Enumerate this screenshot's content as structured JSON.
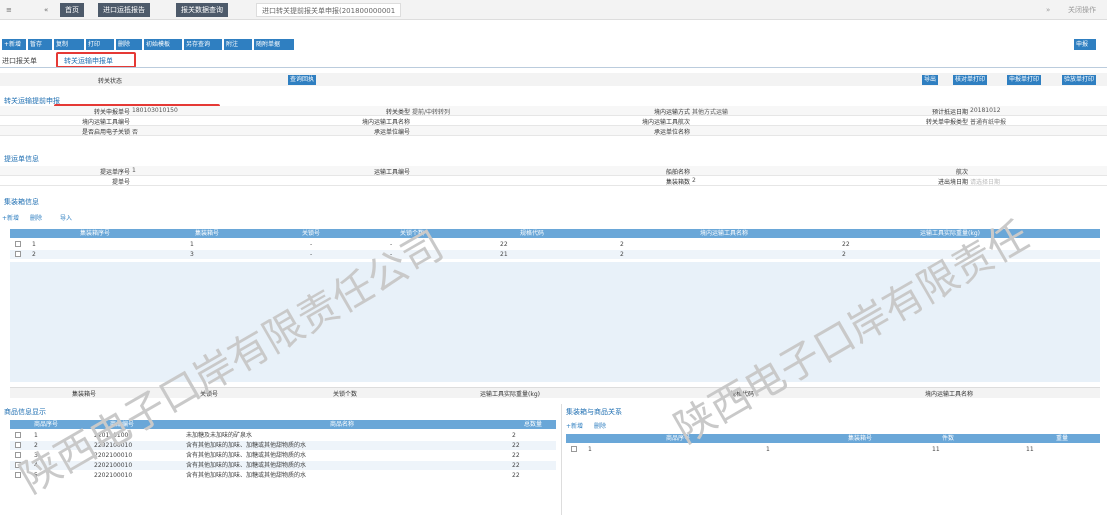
{
  "tabbar": {
    "menu": "≡",
    "back": "«",
    "home": "首页",
    "tab1": "进口运抵报告",
    "tab2": "报关数据查询",
    "tab3": "进口转关提前报关单申报(201800000001",
    "forward": "»",
    "close_ops": "关闭操作"
  },
  "toolbar": {
    "buttons": [
      "+新增",
      "暂存",
      "复制",
      "打印",
      "删除",
      "初始模板",
      "另存查询",
      "附注",
      "随附单据"
    ],
    "declare": "申报"
  },
  "page_tabs": {
    "t1": "进口报关单",
    "t2": "转关运输申报单"
  },
  "status_row": {
    "label": "转关状态",
    "value": "",
    "query_btn": "查询回执",
    "exp": "导出",
    "print_verify": "核对单打印",
    "print_decl": "申报单打印",
    "print_check": "验放单打印"
  },
  "sec1": {
    "title": "转关运输提前申报",
    "rows": [
      [
        {
          "l": "转关申报单号",
          "v": "180103010150"
        },
        {
          "l": "转关类型",
          "v": "提前/中转转列"
        },
        {
          "l": "境内运输方式",
          "v": "其他方式运输"
        },
        {
          "l": "预计抵运日期",
          "v": "20181012"
        }
      ],
      [
        {
          "l": "境内运输工具编号",
          "v": ""
        },
        {
          "l": "境内运输工具名称",
          "v": ""
        },
        {
          "l": "境内运输工具航次",
          "v": ""
        },
        {
          "l": "转关单申报类型",
          "v": "普通有纸申报"
        }
      ],
      [
        {
          "l": "是否启用电子关锁",
          "v": "否"
        },
        {
          "l": "承运单位编号",
          "v": ""
        },
        {
          "l": "承运单位名称",
          "v": ""
        },
        {
          "l": "",
          "v": ""
        }
      ]
    ]
  },
  "sec2": {
    "title": "提运单信息",
    "rows": [
      [
        {
          "l": "提运单序号",
          "v": "1"
        },
        {
          "l": "运输工具编号",
          "v": ""
        },
        {
          "l": "船舶名称",
          "v": ""
        },
        {
          "l": "航次",
          "v": ""
        }
      ],
      [
        {
          "l": "提单号",
          "v": ""
        },
        {
          "l": "",
          "v": ""
        },
        {
          "l": "集装箱数",
          "v": "2"
        },
        {
          "l": "进出境日期",
          "v": "请选择日期"
        }
      ]
    ]
  },
  "sec3": {
    "title": "集装箱信息",
    "actions": [
      "+新增",
      "删除",
      "导入"
    ],
    "headers": [
      "集装箱序号",
      "集装箱号",
      "关锁号",
      "关锁个数",
      "规格代码",
      "境内运输工具名称",
      "运输工具实际重量(kg)"
    ],
    "rows": [
      [
        "1",
        "1",
        "-",
        "-",
        "22",
        "2",
        "22"
      ],
      [
        "2",
        "3",
        "-",
        "-",
        "21",
        "2",
        "2"
      ]
    ],
    "footer": [
      "集装箱号",
      "关锁号",
      "关锁个数",
      "运输工具实际重量(kg)",
      "规格代码",
      "境内运输工具名称"
    ]
  },
  "sec4": {
    "title": "商品信息显示",
    "headers": [
      "商品序号",
      "商品编号",
      "商品名称",
      "总数量"
    ],
    "rows": [
      [
        "1",
        "2201101000",
        "未加糖及未加味的矿泉水",
        "2"
      ],
      [
        "2",
        "2202100010",
        "含有其他加味的加味、加糖或其他甜物质的水",
        "22"
      ],
      [
        "3",
        "2202100010",
        "含有其他加味的加味、加糖或其他甜物质的水",
        "22"
      ],
      [
        "4",
        "2202100010",
        "含有其他加味的加味、加糖或其他甜物质的水",
        "22"
      ],
      [
        "5",
        "2202100010",
        "含有其他加味的加味、加糖或其他甜物质的水",
        "22"
      ]
    ]
  },
  "sec5": {
    "title": "集装箱与商品关系",
    "actions": [
      "+新增",
      "删除"
    ],
    "headers": [
      "商品序号",
      "集装箱号",
      "件数",
      "重量"
    ],
    "rows": [
      [
        "1",
        "1",
        "11",
        "11"
      ]
    ]
  },
  "watermark": [
    "陕西电子口岸有限责任公司",
    "陕西电子口岸有限责任"
  ],
  "colors": {
    "accent": "#2f7fc1",
    "header": "#6aa7d8",
    "highlight": "#e53935"
  }
}
